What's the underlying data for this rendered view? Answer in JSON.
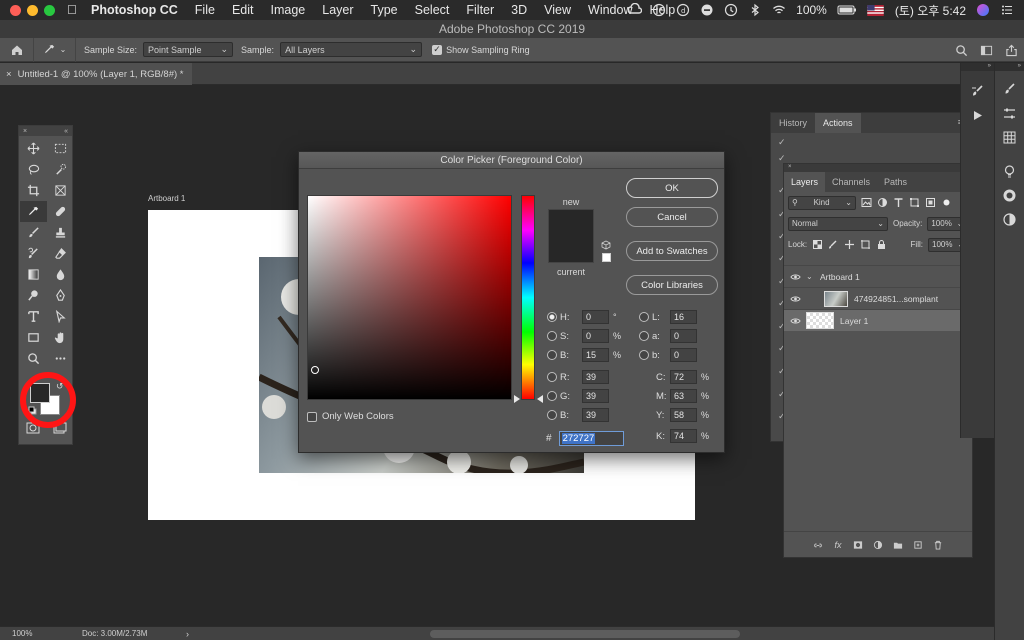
{
  "menubar": {
    "app_name": "Photoshop CC",
    "items": [
      "File",
      "Edit",
      "Image",
      "Layer",
      "Type",
      "Select",
      "Filter",
      "3D",
      "View",
      "Window",
      "Help"
    ],
    "battery": "100%",
    "clock": "(토) 오후 5:42"
  },
  "window": {
    "title": "Adobe Photoshop CC 2019"
  },
  "options": {
    "sample_size_label": "Sample Size:",
    "sample_size_value": "Point Sample",
    "sample_label": "Sample:",
    "sample_value": "All Layers",
    "show_ring_label": "Show Sampling Ring"
  },
  "document": {
    "tab_title": "Untitled-1 @ 100% (Layer 1, RGB/8#) *",
    "artboard_label": "Artboard 1"
  },
  "status": {
    "zoom": "100%",
    "doc_info": "Doc: 3.00M/2.73M"
  },
  "history_panel": {
    "tabs": [
      "History",
      "Actions"
    ],
    "active": "Actions"
  },
  "layers_panel": {
    "tabs": [
      "Layers",
      "Channels",
      "Paths"
    ],
    "filter_label": "Kind",
    "blend_mode": "Normal",
    "opacity_label": "Opacity:",
    "opacity_value": "100%",
    "lock_label": "Lock:",
    "fill_label": "Fill:",
    "fill_value": "100%",
    "layers": [
      {
        "name": "Artboard 1"
      },
      {
        "name": "474924851...somplant"
      },
      {
        "name": "Layer 1"
      }
    ]
  },
  "color_picker": {
    "title": "Color Picker (Foreground Color)",
    "new_label": "new",
    "current_label": "current",
    "buttons": {
      "ok": "OK",
      "cancel": "Cancel",
      "add_swatches": "Add to Swatches",
      "color_libraries": "Color Libraries"
    },
    "only_web_label": "Only Web Colors",
    "fields": {
      "H": "0",
      "S": "0",
      "B": "15",
      "R": "39",
      "G": "39",
      "Bv": "39",
      "L": "16",
      "a": "0",
      "b": "0",
      "C": "72",
      "M": "63",
      "Y": "58",
      "K": "74"
    },
    "units": {
      "degree": "°",
      "pct": "%"
    },
    "hex_label": "#",
    "hex": "272727",
    "current_color": "#272727"
  }
}
